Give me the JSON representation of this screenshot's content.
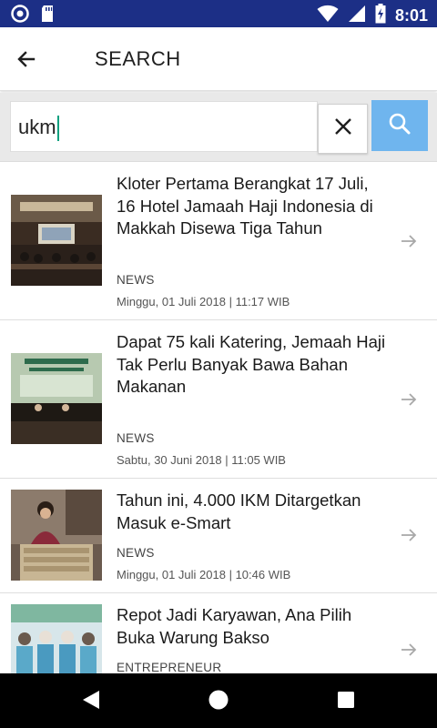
{
  "status_bar": {
    "time": "8:01",
    "left_icons": [
      "circle-notification-icon",
      "sd-card-icon"
    ],
    "right_icons": [
      "wifi-icon",
      "signal-icon",
      "battery-charging-icon"
    ],
    "background": "#1c2f86"
  },
  "app_bar": {
    "title": "SEARCH",
    "back_icon": "arrow-left-icon"
  },
  "search": {
    "value": "ukm",
    "clear_icon": "close-icon",
    "submit_icon": "search-icon",
    "submit_color": "#6fb5ee"
  },
  "results": [
    {
      "title": "Kloter Pertama Berangkat 17 Juli, 16 Hotel Jamaah Haji Indonesia di Makkah Disewa Tiga Tahun",
      "category": "NEWS",
      "date": "Minggu, 01 Juli 2018 | 11:17 WIB",
      "thumb": "conference-hall-photo"
    },
    {
      "title": "Dapat 75 kali Katering, Jemaah Haji Tak Perlu Banyak Bawa Bahan Makanan",
      "category": "NEWS",
      "date": "Sabtu, 30 Juni 2018 | 11:05 WIB",
      "thumb": "seminar-stage-photo"
    },
    {
      "title": "Tahun ini, 4.000 IKM Ditargetkan Masuk e-Smart",
      "category": "NEWS",
      "date": "Minggu, 01 Juli 2018 | 10:46 WIB",
      "thumb": "speaker-podium-photo"
    },
    {
      "title": "Repot Jadi Karyawan, Ana Pilih Buka Warung Bakso",
      "category": "ENTREPRENEUR",
      "date": "",
      "thumb": "group-photo"
    }
  ],
  "nav_bar": {
    "icons": [
      "back-triangle-icon",
      "home-circle-icon",
      "recents-square-icon"
    ]
  }
}
